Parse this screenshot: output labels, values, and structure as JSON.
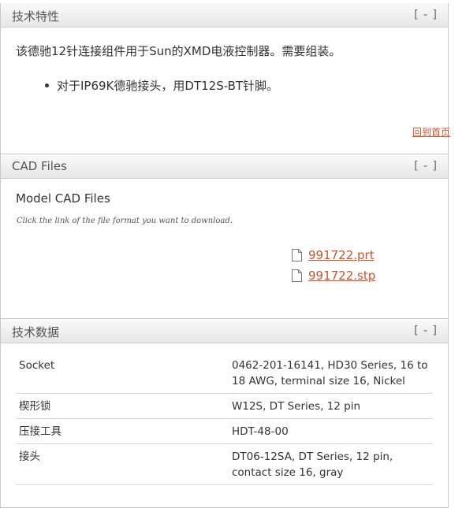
{
  "tech_features": {
    "title": "技术特性",
    "toggle": "[ - ]",
    "intro": "该德驰12针连接组件用于Sun的XMD电液控制器。需要组装。",
    "bullets": [
      "对于IP69K德驰接头，用DT12S-BT针脚。"
    ],
    "back_to_top": "回到首页"
  },
  "cad_files": {
    "title": "CAD Files",
    "toggle": "[ - ]",
    "heading": "Model CAD Files",
    "note": "Click the link of the file format you want to download.",
    "files": [
      {
        "name": "991722.prt",
        "icon": "file-icon"
      },
      {
        "name": "991722.stp",
        "icon": "file-icon"
      }
    ]
  },
  "tech_data": {
    "title": "技术数据",
    "toggle": "[ - ]",
    "rows": [
      {
        "key": "Socket",
        "value": "0462-201-16141, HD30 Series, 16 to 18 AWG, terminal size 16, Nickel"
      },
      {
        "key": "楔形锁",
        "value": "W12S, DT Series, 12 pin"
      },
      {
        "key": "压接工具",
        "value": "HDT-48-00"
      },
      {
        "key": "接头",
        "value": "DT06-12SA, DT Series, 12 pin, contact size 16, gray"
      }
    ]
  },
  "colors": {
    "link": "#d2532a",
    "header_bg": "#e9e9e9",
    "border": "#c8c8c8"
  }
}
